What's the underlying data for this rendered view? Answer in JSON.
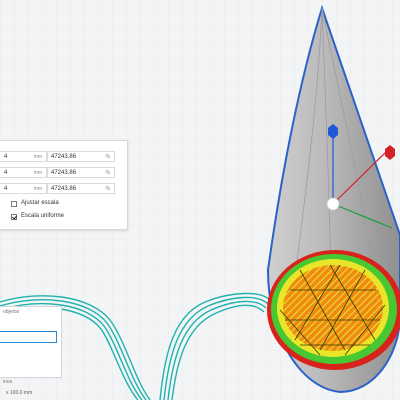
{
  "scale_panel": {
    "rows": [
      {
        "mm_value": "4",
        "mm_unit": "mm",
        "pct_value": "47243.86",
        "pct_unit": "%"
      },
      {
        "mm_value": "4",
        "mm_unit": "mm",
        "pct_value": "47243.86",
        "pct_unit": "%"
      },
      {
        "mm_value": "4",
        "mm_unit": "mm",
        "pct_value": "47243.86",
        "pct_unit": "%"
      }
    ],
    "fit_label": "Ajustar escala",
    "fit_checked": false,
    "uniform_label": "Escala uniforme",
    "uniform_checked": true
  },
  "object_panel": {
    "header": "objetos",
    "footer": "inos"
  },
  "status": {
    "dimensions": "x 100.0 mm"
  },
  "colors": {
    "outline_blue": "#2a62c9",
    "model_gray": "#a8a8a8",
    "infill_yellow": "#e9e62a",
    "wall_green": "#47c832",
    "shell_red": "#d8231c",
    "skirt_cyan": "#1fb2b0",
    "axis_x": "#d52228",
    "axis_y": "#1a9f3c",
    "axis_z": "#2058d8"
  }
}
